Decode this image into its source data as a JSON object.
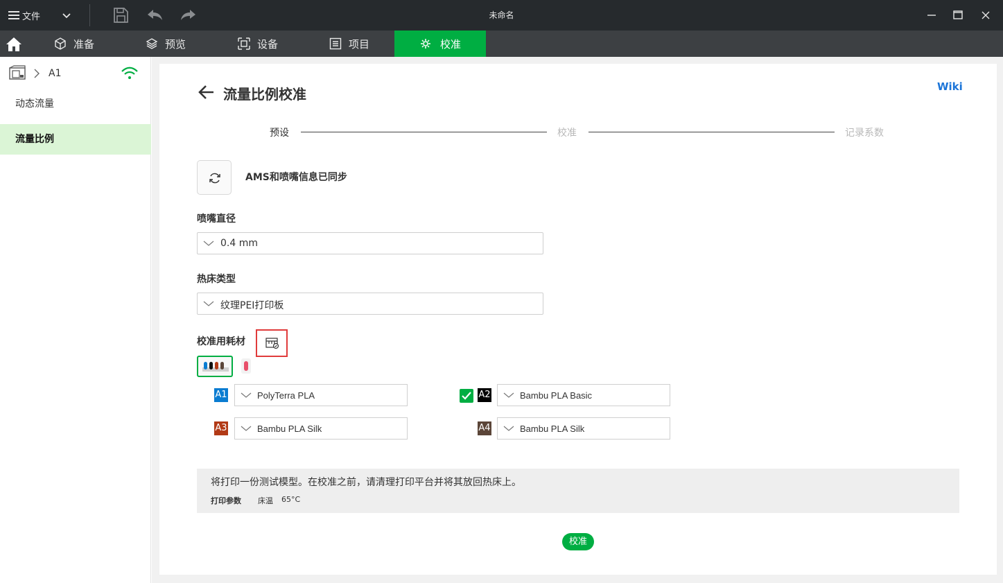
{
  "titlebar": {
    "file_label": "文件",
    "window_title": "未命名"
  },
  "nav": {
    "tabs": [
      {
        "label": "准备",
        "icon": "cube-icon"
      },
      {
        "label": "预览",
        "icon": "layers-icon"
      },
      {
        "label": "设备",
        "icon": "device-icon"
      },
      {
        "label": "项目",
        "icon": "project-icon"
      },
      {
        "label": "校准",
        "icon": "calibration-icon",
        "active": true
      }
    ]
  },
  "sidebar": {
    "printer_name": "A1",
    "items": [
      {
        "label": "动态流量"
      },
      {
        "label": "流量比例",
        "active": true
      }
    ]
  },
  "page": {
    "title": "流量比例校准",
    "wiki_link": "Wiki",
    "steps": [
      "预设",
      "校准",
      "记录系数"
    ],
    "sync_text": "AMS和喷嘴信息已同步",
    "nozzle": {
      "label": "喷嘴直径",
      "value": "0.4 mm"
    },
    "plate": {
      "label": "热床类型",
      "value": "纹理PEI打印板"
    },
    "filament_label": "校准用耗材",
    "slots": [
      {
        "id": "A1",
        "color": "#0a7cd1",
        "filament": "PolyTerra PLA",
        "checked": false
      },
      {
        "id": "A2",
        "color": "#000000",
        "filament": "Bambu PLA Basic",
        "checked": true
      },
      {
        "id": "A3",
        "color": "#b23a16",
        "filament": "Bambu PLA Silk",
        "checked": false
      },
      {
        "id": "A4",
        "color": "#5b4538",
        "filament": "Bambu PLA Silk",
        "checked": false
      }
    ],
    "info": {
      "main": "将打印一份测试模型。在校准之前，请清理打印平台并将其放回热床上。",
      "params_label": "打印参数",
      "bed_label": "床温",
      "bed_value": "65°C"
    },
    "calibrate_button": "校准"
  },
  "colors": {
    "accent": "#00ae42",
    "link": "#1a74d8",
    "highlight_border": "#e03b3b"
  }
}
